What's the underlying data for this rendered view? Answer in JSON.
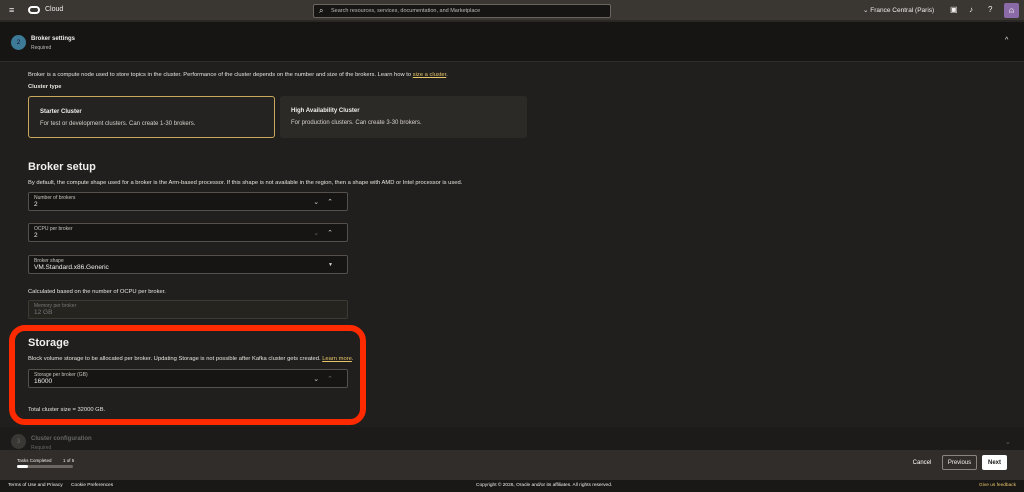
{
  "topbar": {
    "brand": "Cloud",
    "search_placeholder": "Search resources, services, documentation, and Marketplace",
    "region": "France Central (Paris)"
  },
  "section": {
    "step": "2",
    "title": "Broker settings",
    "subtitle": "Required"
  },
  "intro": {
    "text": "Broker is a compute node used to store topics in the cluster. Performance of the cluster depends on the number and size of the brokers. Learn how to ",
    "link": "size a cluster",
    "end": "."
  },
  "cluster_type": {
    "label": "Cluster type",
    "options": [
      {
        "title": "Starter Cluster",
        "desc": "For test or development clusters. Can create 1-30 brokers.",
        "selected": true
      },
      {
        "title": "High Availability Cluster",
        "desc": "For production clusters. Can create 3-30 brokers.",
        "selected": false
      }
    ]
  },
  "broker_setup": {
    "title": "Broker setup",
    "desc": "By default, the compute shape used for a broker is the Arm-based processor. If this shape is not available in the region, then a shape with AMD or Intel processor is used.",
    "num_brokers": {
      "label": "Number of brokers",
      "value": "2"
    },
    "ocpu": {
      "label": "OCPU per broker",
      "value": "2"
    },
    "shape": {
      "label": "Broker shape",
      "value": "VM.Standard.x86.Generic"
    },
    "calc_note": "Calculated based on the number of OCPU per broker.",
    "memory": {
      "label": "Memory per broker",
      "value": "12 GB"
    }
  },
  "storage": {
    "title": "Storage",
    "desc": "Block volume storage to be allocated per broker. Updating Storage is not possible after Kafka cluster gets created. ",
    "link": "Learn more",
    "end": ".",
    "field": {
      "label": "Storage per broker (GB)",
      "value": "16000"
    },
    "total": "Total cluster size = 32000 GB."
  },
  "next_section": {
    "step": "3",
    "title": "Cluster configuration",
    "subtitle": "Required"
  },
  "footer": {
    "tasks_label": "Tasks Completed",
    "tasks_count": "1 of 5",
    "progress": 0.2,
    "cancel": "Cancel",
    "previous": "Previous",
    "next": "Next"
  },
  "bottom": {
    "terms": "Terms of Use and Privacy",
    "cookies": "Cookie Preferences",
    "copyright": "Copyright © 2026, Oracle and/or its affiliates. All rights reserved.",
    "feedback": "Give us feedback"
  },
  "colors": {
    "accent": "#e7c56a",
    "highlight": "#ff2a00"
  }
}
